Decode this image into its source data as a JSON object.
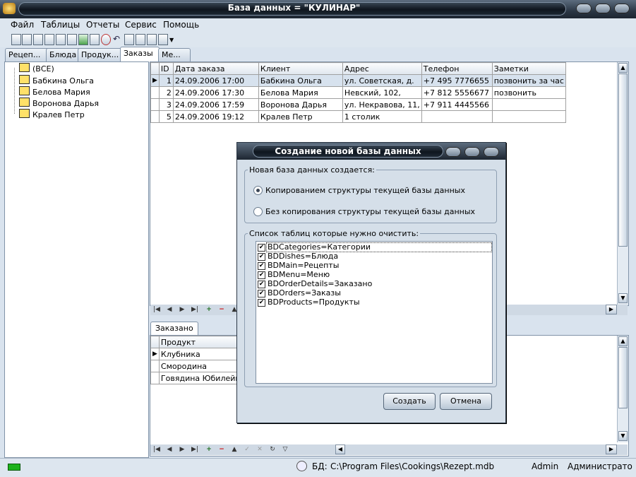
{
  "window": {
    "title": "База данных = \"КУЛИНАР\""
  },
  "menu": [
    "Файл",
    "Таблицы",
    "Отчеты",
    "Сервис",
    "Помощь"
  ],
  "tabs": [
    "Рецеп...",
    "Блюда",
    "Продук...",
    "Заказы",
    "Ме..."
  ],
  "active_tab": "Заказы",
  "tree": {
    "items": [
      "(ВСЕ)",
      "Бабкина Ольга",
      "Белова Мария",
      "Воронова Дарья",
      "Кралев Петр"
    ]
  },
  "grid": {
    "columns": [
      "ID",
      "Дата заказа",
      "Клиент",
      "Адрес",
      "Телефон",
      "Заметки"
    ],
    "rows": [
      [
        "1",
        "24.09.2006 17:00",
        "Бабкина Ольга",
        "ул. Советская, д.",
        "+7 495 7776655",
        "позвонить за час"
      ],
      [
        "2",
        "24.09.2006 17:30",
        "Белова Мария",
        "Невский, 102,",
        "+7 812 5556677",
        "позвонить"
      ],
      [
        "3",
        "24.09.2006 17:59",
        "Воронова Дарья",
        "ул. Некравова, 11,",
        "+7 911 4445566",
        ""
      ],
      [
        "5",
        "24.09.2006 19:12",
        "Кралев Петр",
        "1 столик",
        "",
        ""
      ]
    ]
  },
  "subtab": "Заказано",
  "grid2": {
    "columns": [
      "Продукт"
    ],
    "rows": [
      "Клубника",
      "Смородина",
      "Говядина Юбилейная"
    ]
  },
  "status": {
    "db_label": "БД:",
    "db_path": "C:\\Program Files\\Cookings\\Rezept.mdb",
    "user": "Admin",
    "role": "Администрато"
  },
  "dialog": {
    "title": "Создание новой базы данных",
    "group1_label": "Новая база данных создается:",
    "radio1": "Копированием структуры текущей базы данных",
    "radio2": "Без копирования структуры текущей базы данных",
    "group2_label": "Список таблиц которые нужно очистить:",
    "tables": [
      "BDCategories=Категории",
      "BDDishes=Блюда",
      "BDMain=Рецепты",
      "BDMenu=Меню",
      "BDOrderDetails=Заказано",
      "BDOrders=Заказы",
      "BDProducts=Продукты"
    ],
    "create_label": "Создать",
    "cancel_label": "Отмена"
  }
}
